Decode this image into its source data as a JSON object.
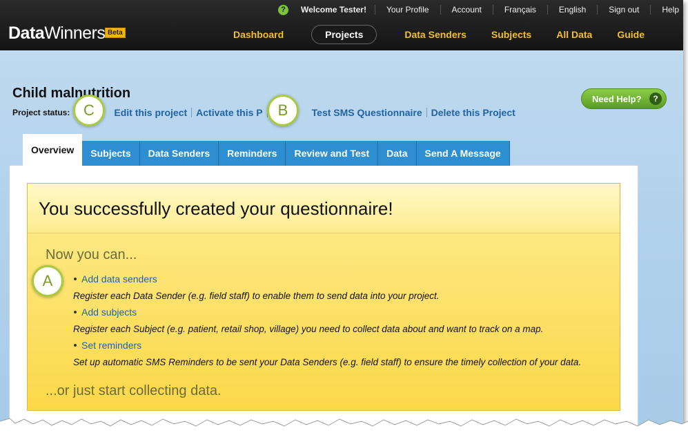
{
  "utility_bar": {
    "help_icon": "?",
    "welcome": "Welcome Tester!",
    "links": [
      "Your Profile",
      "Account",
      "Français",
      "English",
      "Sign out",
      "Help"
    ]
  },
  "logo": {
    "bold": "Data",
    "regular": "Winners",
    "badge": "Beta"
  },
  "main_nav": {
    "items": [
      "Dashboard",
      "Projects",
      "Data Senders",
      "Subjects",
      "All Data",
      "Guide"
    ],
    "active": "Projects"
  },
  "project": {
    "title": "Child malnutrition",
    "status_label": "Project status:",
    "links": [
      "Edit this project",
      "Activate this P",
      "Test SMS Questionnaire",
      "Delete this Project"
    ]
  },
  "need_help": {
    "label": "Need Help?",
    "icon": "?"
  },
  "tabs": {
    "items": [
      "Overview",
      "Subjects",
      "Data Senders",
      "Reminders",
      "Review and Test",
      "Data",
      "Send A Message"
    ],
    "active": "Overview"
  },
  "card": {
    "heading": "You successfully created your questionnaire!",
    "now_text": "Now you can...",
    "items": [
      {
        "link": "Add data senders",
        "desc": "Register each Data Sender (e.g. field staff) to enable them to send data into your project."
      },
      {
        "link": "Add subjects",
        "desc": "Register each Subject (e.g. patient, retail shop, village) you need to collect data about and want to track on a map."
      },
      {
        "link": "Set reminders",
        "desc": "Set up automatic SMS Reminders to be sent your Data Senders (e.g. field staff) to ensure the timely collection of your data."
      }
    ],
    "or_text": "...or just start collecting data."
  },
  "annotations": [
    "C",
    "B",
    "A"
  ],
  "colors": {
    "accent": "#f0c02e",
    "link": "#1d63a6",
    "tab": "#2d8fd1",
    "help_green": "#6fb431"
  }
}
